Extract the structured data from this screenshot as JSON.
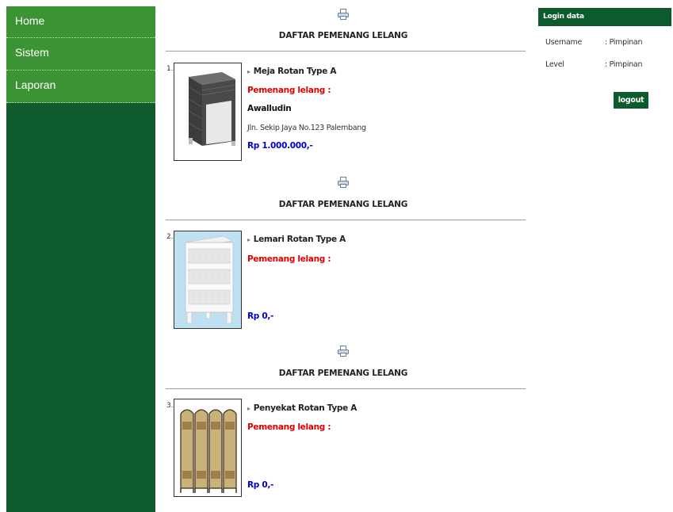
{
  "sidebar": {
    "items": [
      {
        "label": "Home"
      },
      {
        "label": "Sistem"
      },
      {
        "label": "Laporan"
      }
    ]
  },
  "sections": [
    {
      "title": "DAFTAR PEMENANG LELANG",
      "number": "1.",
      "item_name": "Meja Rotan Type A",
      "winner_label": "Pemenang lelang :",
      "winner_name": "Awalludin",
      "winner_address": "Jln. Sekip Jaya No.123 Palembang",
      "price": "Rp 1.000.000,-"
    },
    {
      "title": "DAFTAR PEMENANG LELANG",
      "number": "2.",
      "item_name": "Lemari Rotan Type A",
      "winner_label": "Pemenang lelang :",
      "price": "Rp 0,-"
    },
    {
      "title": "DAFTAR PEMENANG LELANG",
      "number": "3.",
      "item_name": "Penyekat Rotan Type A",
      "winner_label": "Pemenang lelang :",
      "price": "Rp 0,-"
    }
  ],
  "login": {
    "title": "Login data",
    "username_label": "Username",
    "username_value": ": Pimpinan",
    "level_label": "Level",
    "level_value": ": Pimpinan",
    "logout_label": "logout"
  },
  "colors": {
    "sidebar_dark": "#0d5b2c",
    "nav_green": "#3c9334",
    "winner_red": "#e00000",
    "price_blue": "#0000cc"
  }
}
